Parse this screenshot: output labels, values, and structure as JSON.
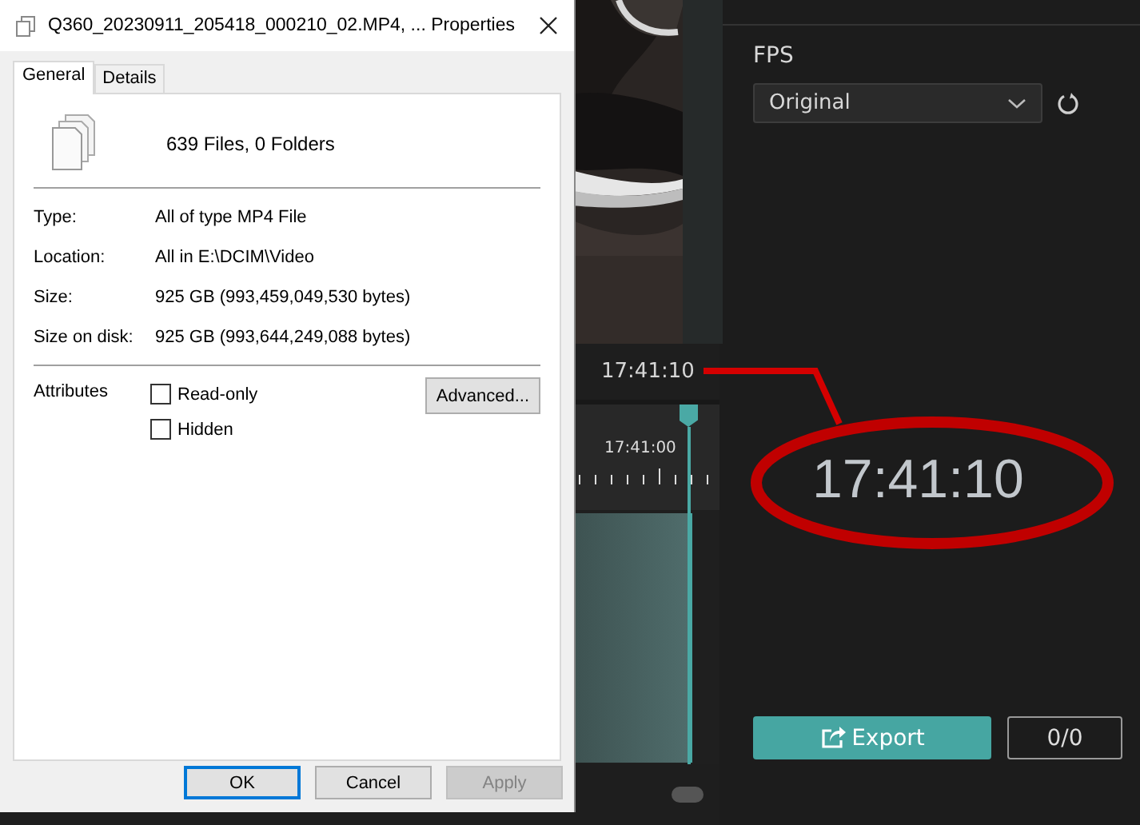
{
  "properties_dialog": {
    "title": "Q360_20230911_205418_000210_02.MP4, ... Properties",
    "tabs": [
      {
        "label": "General",
        "selected": true
      },
      {
        "label": "Details",
        "selected": false
      }
    ],
    "summary": "639 Files, 0 Folders",
    "properties": [
      {
        "label": "Type:",
        "value": "All of type MP4 File"
      },
      {
        "label": "Location:",
        "value": "All in E:\\DCIM\\Video"
      },
      {
        "label": "Size:",
        "value": "925 GB (993,459,049,530 bytes)"
      },
      {
        "label": "Size on disk:",
        "value": "925 GB (993,644,249,088 bytes)"
      }
    ],
    "attributes": {
      "label": "Attributes",
      "checkboxes": [
        {
          "label": "Read-only",
          "checked": false
        },
        {
          "label": "Hidden",
          "checked": false
        }
      ],
      "advanced_button": "Advanced..."
    },
    "buttons": [
      {
        "label": "OK",
        "default": true,
        "disabled": false
      },
      {
        "label": "Cancel",
        "default": false,
        "disabled": false
      },
      {
        "label": "Apply",
        "default": false,
        "disabled": true
      }
    ]
  },
  "editor": {
    "timecode": "17:41:10",
    "timeline": {
      "ruler_label": "17:41:00"
    }
  },
  "export_panel": {
    "fps_label": "FPS",
    "fps_select": {
      "value": "Original"
    },
    "export_button": "Export",
    "counter": "0/0"
  },
  "annotation": {
    "callout_text": "17:41:10"
  }
}
